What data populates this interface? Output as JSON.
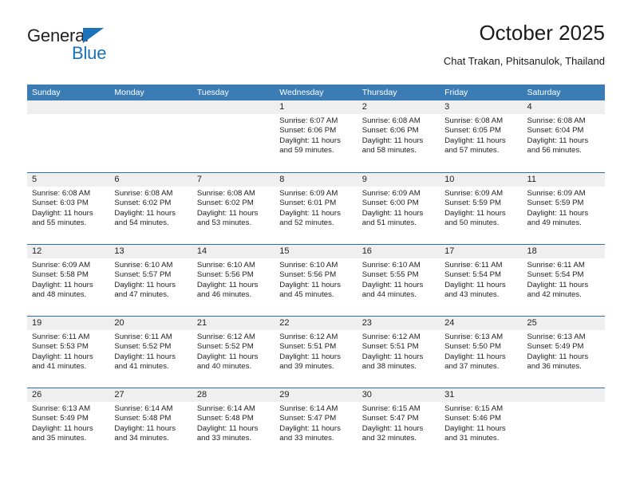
{
  "brand": {
    "line1": "General",
    "line2": "Blue",
    "triangle_color": "#1a72b8"
  },
  "header": {
    "title": "October 2025",
    "subtitle": "Chat Trakan, Phitsanulok, Thailand"
  },
  "theme": {
    "header_blue": "#3b7cb5",
    "row_divider_blue": "#2f6da8",
    "day_band_gray": "#efefef"
  },
  "calendar": {
    "weekdays": [
      "Sunday",
      "Monday",
      "Tuesday",
      "Wednesday",
      "Thursday",
      "Friday",
      "Saturday"
    ],
    "weeks": [
      [
        {
          "day": "",
          "lines": []
        },
        {
          "day": "",
          "lines": []
        },
        {
          "day": "",
          "lines": []
        },
        {
          "day": "1",
          "lines": [
            "Sunrise: 6:07 AM",
            "Sunset: 6:06 PM",
            "Daylight: 11 hours and 59 minutes."
          ]
        },
        {
          "day": "2",
          "lines": [
            "Sunrise: 6:08 AM",
            "Sunset: 6:06 PM",
            "Daylight: 11 hours and 58 minutes."
          ]
        },
        {
          "day": "3",
          "lines": [
            "Sunrise: 6:08 AM",
            "Sunset: 6:05 PM",
            "Daylight: 11 hours and 57 minutes."
          ]
        },
        {
          "day": "4",
          "lines": [
            "Sunrise: 6:08 AM",
            "Sunset: 6:04 PM",
            "Daylight: 11 hours and 56 minutes."
          ]
        }
      ],
      [
        {
          "day": "5",
          "lines": [
            "Sunrise: 6:08 AM",
            "Sunset: 6:03 PM",
            "Daylight: 11 hours and 55 minutes."
          ]
        },
        {
          "day": "6",
          "lines": [
            "Sunrise: 6:08 AM",
            "Sunset: 6:02 PM",
            "Daylight: 11 hours and 54 minutes."
          ]
        },
        {
          "day": "7",
          "lines": [
            "Sunrise: 6:08 AM",
            "Sunset: 6:02 PM",
            "Daylight: 11 hours and 53 minutes."
          ]
        },
        {
          "day": "8",
          "lines": [
            "Sunrise: 6:09 AM",
            "Sunset: 6:01 PM",
            "Daylight: 11 hours and 52 minutes."
          ]
        },
        {
          "day": "9",
          "lines": [
            "Sunrise: 6:09 AM",
            "Sunset: 6:00 PM",
            "Daylight: 11 hours and 51 minutes."
          ]
        },
        {
          "day": "10",
          "lines": [
            "Sunrise: 6:09 AM",
            "Sunset: 5:59 PM",
            "Daylight: 11 hours and 50 minutes."
          ]
        },
        {
          "day": "11",
          "lines": [
            "Sunrise: 6:09 AM",
            "Sunset: 5:59 PM",
            "Daylight: 11 hours and 49 minutes."
          ]
        }
      ],
      [
        {
          "day": "12",
          "lines": [
            "Sunrise: 6:09 AM",
            "Sunset: 5:58 PM",
            "Daylight: 11 hours and 48 minutes."
          ]
        },
        {
          "day": "13",
          "lines": [
            "Sunrise: 6:10 AM",
            "Sunset: 5:57 PM",
            "Daylight: 11 hours and 47 minutes."
          ]
        },
        {
          "day": "14",
          "lines": [
            "Sunrise: 6:10 AM",
            "Sunset: 5:56 PM",
            "Daylight: 11 hours and 46 minutes."
          ]
        },
        {
          "day": "15",
          "lines": [
            "Sunrise: 6:10 AM",
            "Sunset: 5:56 PM",
            "Daylight: 11 hours and 45 minutes."
          ]
        },
        {
          "day": "16",
          "lines": [
            "Sunrise: 6:10 AM",
            "Sunset: 5:55 PM",
            "Daylight: 11 hours and 44 minutes."
          ]
        },
        {
          "day": "17",
          "lines": [
            "Sunrise: 6:11 AM",
            "Sunset: 5:54 PM",
            "Daylight: 11 hours and 43 minutes."
          ]
        },
        {
          "day": "18",
          "lines": [
            "Sunrise: 6:11 AM",
            "Sunset: 5:54 PM",
            "Daylight: 11 hours and 42 minutes."
          ]
        }
      ],
      [
        {
          "day": "19",
          "lines": [
            "Sunrise: 6:11 AM",
            "Sunset: 5:53 PM",
            "Daylight: 11 hours and 41 minutes."
          ]
        },
        {
          "day": "20",
          "lines": [
            "Sunrise: 6:11 AM",
            "Sunset: 5:52 PM",
            "Daylight: 11 hours and 41 minutes."
          ]
        },
        {
          "day": "21",
          "lines": [
            "Sunrise: 6:12 AM",
            "Sunset: 5:52 PM",
            "Daylight: 11 hours and 40 minutes."
          ]
        },
        {
          "day": "22",
          "lines": [
            "Sunrise: 6:12 AM",
            "Sunset: 5:51 PM",
            "Daylight: 11 hours and 39 minutes."
          ]
        },
        {
          "day": "23",
          "lines": [
            "Sunrise: 6:12 AM",
            "Sunset: 5:51 PM",
            "Daylight: 11 hours and 38 minutes."
          ]
        },
        {
          "day": "24",
          "lines": [
            "Sunrise: 6:13 AM",
            "Sunset: 5:50 PM",
            "Daylight: 11 hours and 37 minutes."
          ]
        },
        {
          "day": "25",
          "lines": [
            "Sunrise: 6:13 AM",
            "Sunset: 5:49 PM",
            "Daylight: 11 hours and 36 minutes."
          ]
        }
      ],
      [
        {
          "day": "26",
          "lines": [
            "Sunrise: 6:13 AM",
            "Sunset: 5:49 PM",
            "Daylight: 11 hours and 35 minutes."
          ]
        },
        {
          "day": "27",
          "lines": [
            "Sunrise: 6:14 AM",
            "Sunset: 5:48 PM",
            "Daylight: 11 hours and 34 minutes."
          ]
        },
        {
          "day": "28",
          "lines": [
            "Sunrise: 6:14 AM",
            "Sunset: 5:48 PM",
            "Daylight: 11 hours and 33 minutes."
          ]
        },
        {
          "day": "29",
          "lines": [
            "Sunrise: 6:14 AM",
            "Sunset: 5:47 PM",
            "Daylight: 11 hours and 33 minutes."
          ]
        },
        {
          "day": "30",
          "lines": [
            "Sunrise: 6:15 AM",
            "Sunset: 5:47 PM",
            "Daylight: 11 hours and 32 minutes."
          ]
        },
        {
          "day": "31",
          "lines": [
            "Sunrise: 6:15 AM",
            "Sunset: 5:46 PM",
            "Daylight: 11 hours and 31 minutes."
          ]
        },
        {
          "day": "",
          "lines": []
        }
      ]
    ]
  }
}
